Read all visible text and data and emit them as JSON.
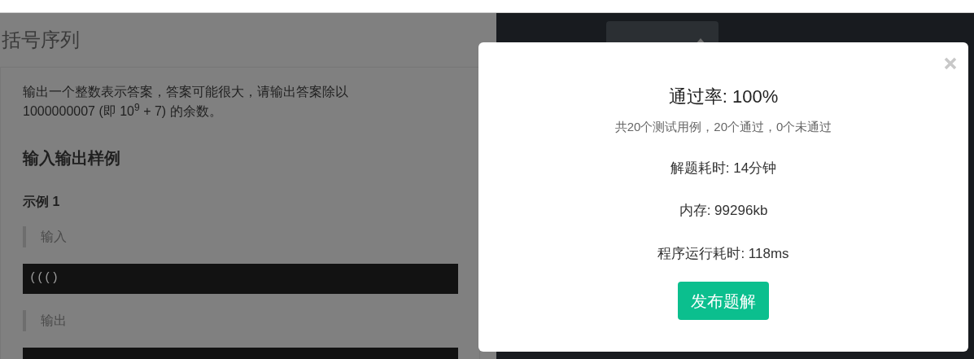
{
  "problem": {
    "title": "括号序列",
    "description": [
      "输出一个整数表示答案，答案可能很大，请输出答案除以",
      "1000000007 (即 10$^{9}$ + 7) 的余数。"
    ],
    "section_heading": "输入输出样例",
    "example_title": "示例 1",
    "input_label": "输入",
    "input_code": "((()",
    "output_label": "输出"
  },
  "result_dialog": {
    "title": "通过率: 100%",
    "summary": "共20个测试用例，20个通过，0个未通过",
    "stats": [
      "解题耗时: 14分钟",
      "内存: 99296kb",
      "程序运行耗时: 118ms"
    ],
    "button": "发布题解"
  }
}
